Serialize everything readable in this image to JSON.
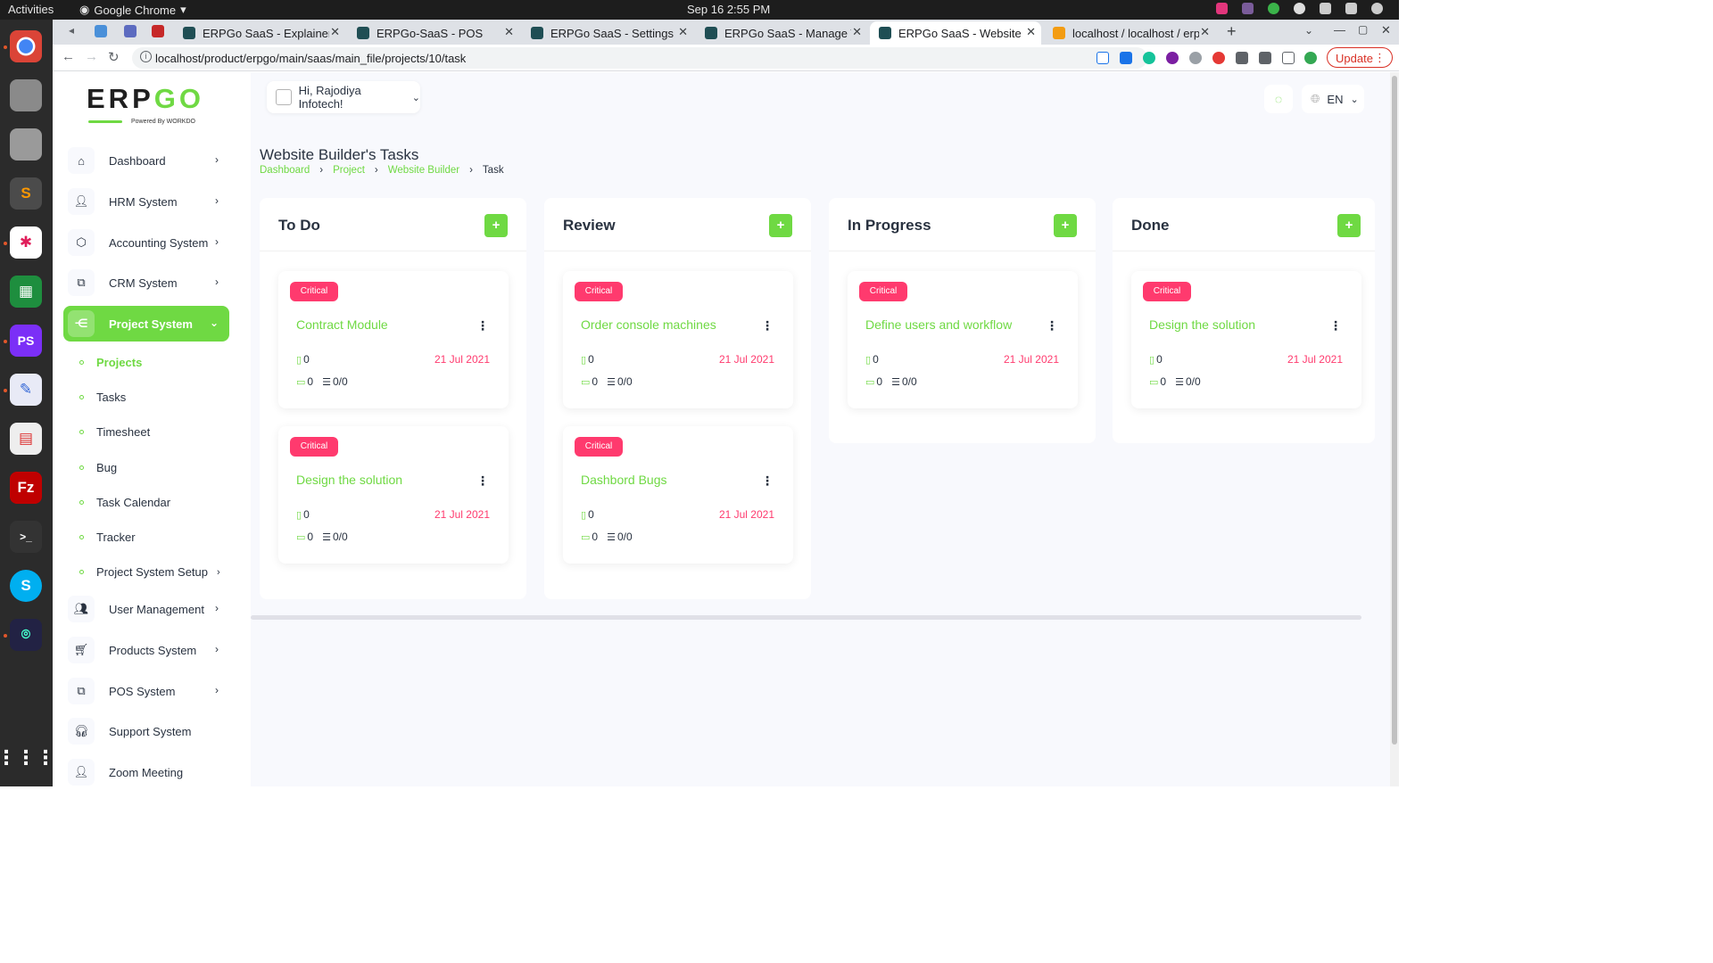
{
  "system_bar": {
    "activities": "Activities",
    "app_name": "Google Chrome",
    "clock": "Sep 16  2:55 PM"
  },
  "dock": {
    "icons": [
      "chrome-icon",
      "files-icon",
      "archive-icon",
      "sublime-text-icon",
      "slack-icon",
      "spreadsheet-icon",
      "phpstorm-icon",
      "text-editor-icon",
      "document-viewer-icon",
      "filezilla-icon",
      "terminal-icon",
      "skype-icon",
      "screenshot-icon"
    ],
    "apps_grid": "apps-grid-icon"
  },
  "browser": {
    "tabs": [
      {
        "title": "ERPGo SaaS - Explainer Te"
      },
      {
        "title": "ERPGo-SaaS - POS"
      },
      {
        "title": "ERPGo SaaS - Settings"
      },
      {
        "title": "ERPGo SaaS - Manage Tra"
      },
      {
        "title": "ERPGo SaaS - Website Bui"
      },
      {
        "title": "localhost / localhost / erp"
      }
    ],
    "url": "localhost/product/erpgo/main/saas/main_file/projects/10/task",
    "update_label": "Update"
  },
  "header": {
    "greeting": "Hi, Rajodiya Infotech!",
    "language": "EN"
  },
  "logo": {
    "text_a": "ERP",
    "text_b": "GO",
    "powered": "Powered By WORKDO"
  },
  "sidebar": {
    "items": [
      {
        "label": "Dashboard"
      },
      {
        "label": "HRM System"
      },
      {
        "label": "Accounting System"
      },
      {
        "label": "CRM System"
      },
      {
        "label": "Project System"
      },
      {
        "label": "User Management"
      },
      {
        "label": "Products System"
      },
      {
        "label": "POS System"
      },
      {
        "label": "Support System"
      },
      {
        "label": "Zoom Meeting"
      }
    ],
    "sub_items": [
      {
        "label": "Projects"
      },
      {
        "label": "Tasks"
      },
      {
        "label": "Timesheet"
      },
      {
        "label": "Bug"
      },
      {
        "label": "Task Calendar"
      },
      {
        "label": "Tracker"
      },
      {
        "label": "Project System Setup"
      }
    ]
  },
  "page": {
    "title": "Website Builder's Tasks",
    "breadcrumb": [
      "Dashboard",
      "Project",
      "Website Builder",
      "Task"
    ]
  },
  "board": {
    "add_label": "+",
    "columns": [
      {
        "title": "To Do",
        "cards": [
          {
            "priority": "Critical",
            "name": "Contract Module",
            "files": "0",
            "date": "21 Jul 2021",
            "comments": "0",
            "checklist": "0/0"
          },
          {
            "priority": "Critical",
            "name": "Design the solution",
            "files": "0",
            "date": "21 Jul 2021",
            "comments": "0",
            "checklist": "0/0"
          }
        ]
      },
      {
        "title": "Review",
        "cards": [
          {
            "priority": "Critical",
            "name": "Order console machines",
            "files": "0",
            "date": "21 Jul 2021",
            "comments": "0",
            "checklist": "0/0"
          },
          {
            "priority": "Critical",
            "name": "Dashbord Bugs",
            "files": "0",
            "date": "21 Jul 2021",
            "comments": "0",
            "checklist": "0/0"
          }
        ]
      },
      {
        "title": "In Progress",
        "cards": [
          {
            "priority": "Critical",
            "name": "Define users and workflow",
            "files": "0",
            "date": "21 Jul 2021",
            "comments": "0",
            "checklist": "0/0"
          }
        ]
      },
      {
        "title": "Done",
        "cards": [
          {
            "priority": "Critical",
            "name": "Design the solution",
            "files": "0",
            "date": "21 Jul 2021",
            "comments": "0",
            "checklist": "0/0"
          }
        ]
      }
    ]
  },
  "colors": {
    "accent": "#6fd943",
    "critical": "#ff3a6e",
    "text": "#293240",
    "background": "#f8f9fd"
  }
}
